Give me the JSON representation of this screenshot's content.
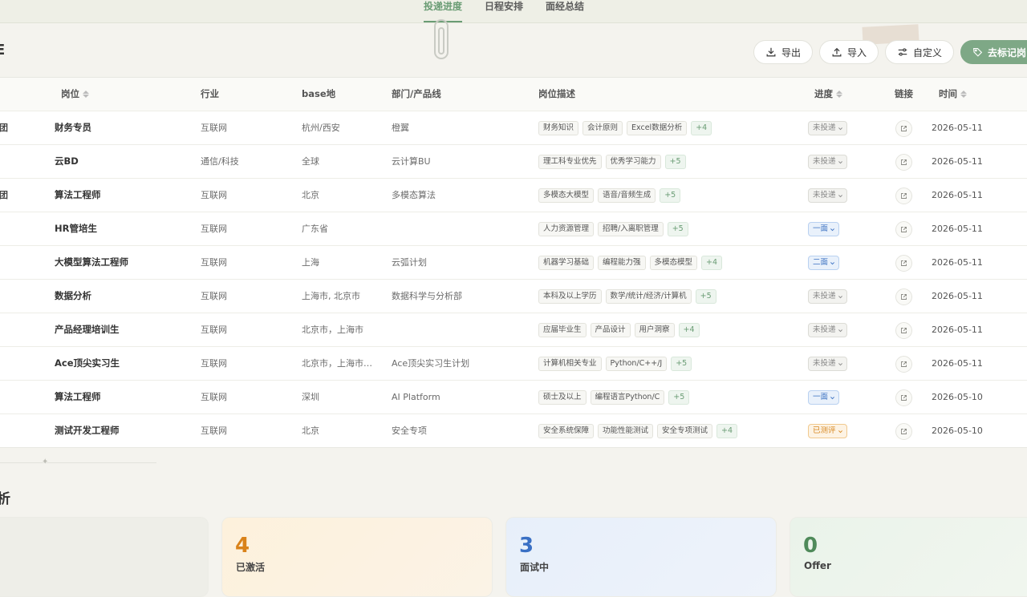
{
  "nav": {
    "tabs": [
      {
        "label": "投递进度",
        "active": true
      },
      {
        "label": "日程安排",
        "active": false
      },
      {
        "label": "面经总结",
        "active": false
      }
    ]
  },
  "header": {
    "title_fragment": "E"
  },
  "toolbar": {
    "export_label": "导出",
    "import_label": "导入",
    "customize_label": "自定义",
    "mark_label": "去标记岗"
  },
  "table": {
    "columns": {
      "title": "岗位",
      "industry": "行业",
      "base": "base地",
      "dept": "部门/产品线",
      "desc": "岗位描述",
      "progress": "进度",
      "link": "链接",
      "time": "时间"
    },
    "rows": [
      {
        "company": "集团",
        "title": "财务专员",
        "industry": "互联网",
        "base": "杭州/西安",
        "dept": "橙翼",
        "tags": [
          "财务知识",
          "会计原则",
          "Excel数据分析"
        ],
        "more": "+4",
        "status": "未投递",
        "status_type": "none",
        "time": "2026-05-11"
      },
      {
        "company": "",
        "title": "云BD",
        "industry": "通信/科技",
        "base": "全球",
        "dept": "云计算BU",
        "tags": [
          "理工科专业优先",
          "优秀学习能力"
        ],
        "more": "+5",
        "status": "未投递",
        "status_type": "none",
        "time": "2026-05-11"
      },
      {
        "company": "集团",
        "title": "算法工程师",
        "industry": "互联网",
        "base": "北京",
        "dept": "多模态算法",
        "tags": [
          "多模态大模型",
          "语音/音频生成"
        ],
        "more": "+5",
        "status": "未投递",
        "status_type": "none",
        "time": "2026-05-11"
      },
      {
        "company": "",
        "title": "HR管培生",
        "industry": "互联网",
        "base": "广东省",
        "dept": "",
        "tags": [
          "人力资源管理",
          "招聘/入离职管理"
        ],
        "more": "+5",
        "status": "一面",
        "status_type": "blue",
        "time": "2026-05-11"
      },
      {
        "company": "",
        "title": "大模型算法工程师",
        "industry": "互联网",
        "base": "上海",
        "dept": "云弧计划",
        "tags": [
          "机器学习基础",
          "编程能力强",
          "多模态模型"
        ],
        "more": "+4",
        "status": "二面",
        "status_type": "blue",
        "time": "2026-05-11"
      },
      {
        "company": "",
        "title": "数据分析",
        "industry": "互联网",
        "base": "上海市, 北京市",
        "dept": "数据科学与分析部",
        "tags": [
          "本科及以上学历",
          "数学/统计/经济/计算机"
        ],
        "more": "+5",
        "status": "未投递",
        "status_type": "none",
        "time": "2026-05-11"
      },
      {
        "company": "",
        "title": "产品经理培训生",
        "industry": "互联网",
        "base": "北京市，上海市",
        "dept": "",
        "tags": [
          "应届毕业生",
          "产品设计",
          "用户洞察"
        ],
        "more": "+4",
        "status": "未投递",
        "status_type": "none",
        "time": "2026-05-11"
      },
      {
        "company": "",
        "title": "Ace顶尖实习生",
        "industry": "互联网",
        "base": "北京市，上海市…",
        "dept": "Ace顶尖实习生计划",
        "tags": [
          "计算机相关专业",
          "Python/C++/J"
        ],
        "more": "+5",
        "status": "未投递",
        "status_type": "none",
        "time": "2026-05-11"
      },
      {
        "company": "",
        "title": "算法工程师",
        "industry": "互联网",
        "base": "深圳",
        "dept": "AI Platform",
        "tags": [
          "硕士及以上",
          "编程语言Python/C"
        ],
        "more": "+5",
        "status": "一面",
        "status_type": "blue",
        "time": "2026-05-10"
      },
      {
        "company": "",
        "title": "测试开发工程师",
        "industry": "互联网",
        "base": "北京",
        "dept": "安全专项",
        "tags": [
          "安全系统保障",
          "功能性能测试",
          "安全专项测试"
        ],
        "more": "+4",
        "status": "已测评",
        "status_type": "orange",
        "time": "2026-05-10"
      }
    ]
  },
  "analysis": {
    "title_fragment": "析",
    "cards": [
      {
        "value": "",
        "label": "",
        "color": "#e8e8e2"
      },
      {
        "value": "4",
        "label": "已激活",
        "color": "#d9821a"
      },
      {
        "value": "3",
        "label": "面试中",
        "color": "#3a70c4"
      },
      {
        "value": "0",
        "label": "Offer",
        "color": "#4f8a5a"
      }
    ]
  }
}
